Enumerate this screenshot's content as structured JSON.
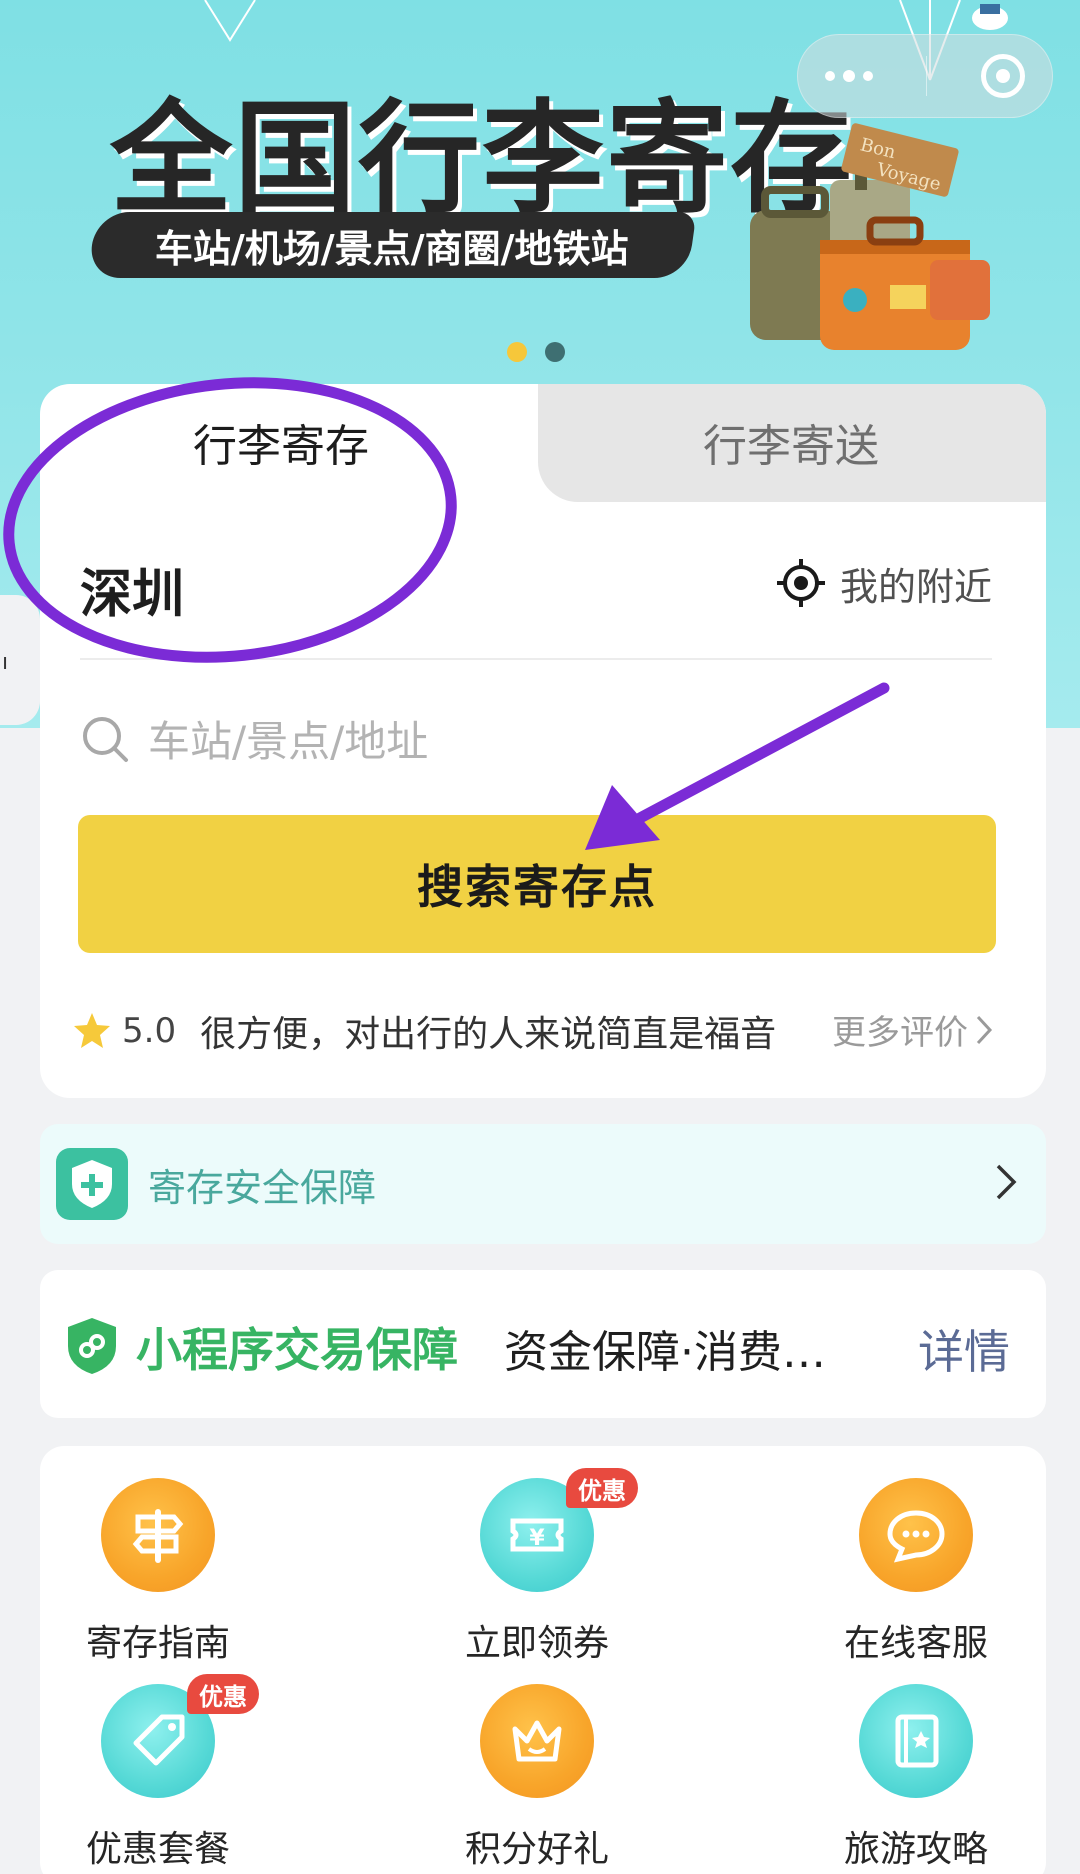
{
  "banner": {
    "title": "全国行李寄存",
    "subtitle": "车站/机场/景点/商圈/地铁站",
    "carousel": {
      "count": 2,
      "active_index": 0
    }
  },
  "capsule": {
    "more_icon": "more-dots-icon",
    "close_icon": "close-target-icon"
  },
  "edge_tab": {
    "text": "ı"
  },
  "tabs": [
    {
      "label": "行李寄存",
      "active": true
    },
    {
      "label": "行李寄送",
      "active": false
    }
  ],
  "search": {
    "city": "深圳",
    "nearby_label": "我的附近",
    "placeholder": "车站/景点/地址",
    "button_label": "搜索寄存点"
  },
  "review": {
    "score": "5.0",
    "text": "很方便，对出行的人来说简直是福音",
    "more_label": "更多评价"
  },
  "safety": {
    "label": "寄存安全保障"
  },
  "guarantee": {
    "title": "小程序交易保障",
    "description": "资金保障·消费…",
    "link": "详情"
  },
  "grid": [
    {
      "label": "寄存指南",
      "icon": "signpost-icon",
      "color": "orange",
      "badge": ""
    },
    {
      "label": "立即领券",
      "icon": "coupon-icon",
      "color": "teal",
      "badge": "优惠"
    },
    {
      "label": "在线客服",
      "icon": "chat-icon",
      "color": "orange",
      "badge": ""
    },
    {
      "label": "优惠套餐",
      "icon": "tag-icon",
      "color": "teal",
      "badge": "优惠"
    },
    {
      "label": "积分好礼",
      "icon": "crown-icon",
      "color": "orange",
      "badge": ""
    },
    {
      "label": "旅游攻略",
      "icon": "guidebook-icon",
      "color": "teal",
      "badge": ""
    }
  ],
  "colors": {
    "accent_yellow": "#f1d143",
    "banner_teal": "#8fe4e8",
    "annotation_purple": "#7b2bd6",
    "guarantee_green": "#37b463",
    "badge_red": "#e84a3f"
  }
}
